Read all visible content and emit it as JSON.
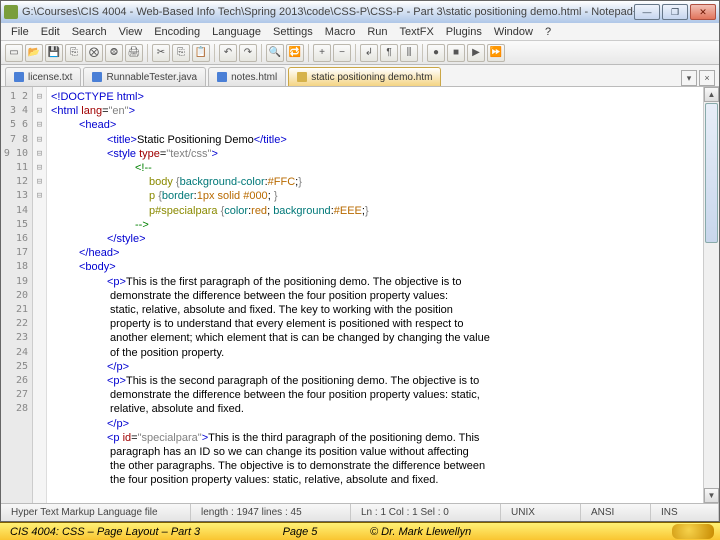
{
  "titlebar": {
    "title": "G:\\Courses\\CIS 4004 - Web-Based Info Tech\\Spring 2013\\code\\CSS-P\\CSS-P - Part 3\\static positioning demo.html - Notepad++"
  },
  "menubar": [
    "File",
    "Edit",
    "Search",
    "View",
    "Encoding",
    "Language",
    "Settings",
    "Macro",
    "Run",
    "TextFX",
    "Plugins",
    "Window",
    "?"
  ],
  "tabs": [
    {
      "label": "license.txt",
      "active": false,
      "color": "blue"
    },
    {
      "label": "RunnableTester.java",
      "active": false,
      "color": "blue"
    },
    {
      "label": "notes.html",
      "active": false,
      "color": "blue"
    },
    {
      "label": "static positioning demo.htm",
      "active": true,
      "color": "yel"
    }
  ],
  "lines": [
    {
      "n": 1,
      "f": "",
      "html": "<span class='c-blue'>&lt;!DOCTYPE html&gt;</span>"
    },
    {
      "n": 2,
      "f": "⊟",
      "html": "<span class='c-blue'>&lt;html</span> <span class='c-red'>lang</span>=<span class='c-gray'>\"en\"</span><span class='c-blue'>&gt;</span>"
    },
    {
      "n": 3,
      "f": "⊟",
      "html": "<span class='in1'><span class='c-blue'>&lt;head&gt;</span></span>"
    },
    {
      "n": 4,
      "f": "",
      "html": "<span class='in2'><span class='c-blue'>&lt;title&gt;</span>Static Positioning Demo<span class='c-blue'>&lt;/title&gt;</span></span>"
    },
    {
      "n": 5,
      "f": "⊟",
      "html": "<span class='in2'><span class='c-blue'>&lt;style</span> <span class='c-red'>type</span>=<span class='c-gray'>\"text/css\"</span><span class='c-blue'>&gt;</span></span>"
    },
    {
      "n": 6,
      "f": "⊟",
      "html": "<span class='in3'><span class='c-green'>&lt;!--</span></span>"
    },
    {
      "n": 7,
      "f": "",
      "html": "<span class='in4'><span class='c-olive'>body</span> <span class='c-gray'>{</span><span class='c-teal'>background-color</span>:<span class='c-orange'>#FFC</span>;<span class='c-gray'>}</span></span>"
    },
    {
      "n": 8,
      "f": "",
      "html": "<span class='in4'><span class='c-olive'>p</span> <span class='c-gray'>{</span><span class='c-teal'>border</span>:<span class='c-orange'>1px solid #000</span>; <span class='c-gray'>}</span></span>"
    },
    {
      "n": 9,
      "f": "",
      "html": "<span class='in4'><span class='c-olive'>p#specialpara</span> <span class='c-gray'>{</span><span class='c-teal'>color</span>:<span class='c-orange'>red</span>; <span class='c-teal'>background</span>:<span class='c-orange'>#EEE</span>;<span class='c-gray'>}</span></span>"
    },
    {
      "n": 10,
      "f": "",
      "html": "<span class='in3'><span class='c-green'>--&gt;</span></span>"
    },
    {
      "n": 11,
      "f": "",
      "html": "<span class='in2'><span class='c-blue'>&lt;/style&gt;</span></span>"
    },
    {
      "n": 12,
      "f": "",
      "html": "<span class='in1'><span class='c-blue'>&lt;/head&gt;</span></span>"
    },
    {
      "n": 13,
      "f": "⊟",
      "html": "<span class='in1'><span class='c-blue'>&lt;body&gt;</span></span>"
    },
    {
      "n": 14,
      "f": "⊟",
      "html": "<span class='in2'><span class='c-blue'>&lt;p&gt;</span>This is the first paragraph of the positioning demo. The objective is to</span>"
    },
    {
      "n": 15,
      "f": "",
      "html": "<span class='in2'> demonstrate the difference between the four position property values:</span>"
    },
    {
      "n": 16,
      "f": "",
      "html": "<span class='in2'> static, relative, absolute and fixed. The key to working with the position</span>"
    },
    {
      "n": 17,
      "f": "",
      "html": "<span class='in2'> property is to understand that every element is positioned with respect to</span>"
    },
    {
      "n": 18,
      "f": "",
      "html": "<span class='in2'> another element; which element that is can be changed by changing the value</span>"
    },
    {
      "n": 19,
      "f": "",
      "html": "<span class='in2'> of the position property.</span>"
    },
    {
      "n": 20,
      "f": "",
      "html": "<span class='in2'><span class='c-blue'>&lt;/p&gt;</span></span>"
    },
    {
      "n": 21,
      "f": "⊟",
      "html": "<span class='in2'><span class='c-blue'>&lt;p&gt;</span>This is the second paragraph of the positioning demo. The objective is to</span>"
    },
    {
      "n": 22,
      "f": "",
      "html": "<span class='in2'> demonstrate the difference between the four position property values: static,</span>"
    },
    {
      "n": 23,
      "f": "",
      "html": "<span class='in2'> relative, absolute and fixed.</span>"
    },
    {
      "n": 24,
      "f": "",
      "html": "<span class='in2'><span class='c-blue'>&lt;/p&gt;</span></span>"
    },
    {
      "n": 25,
      "f": "⊟",
      "html": "<span class='in2'><span class='c-blue'>&lt;p</span> <span class='c-red'>id</span>=<span class='c-gray'>\"specialpara\"</span><span class='c-blue'>&gt;</span>This is the third paragraph of the positioning demo. This</span>"
    },
    {
      "n": 26,
      "f": "",
      "html": "<span class='in2'> paragraph has an ID so we can change its position value without affecting</span>"
    },
    {
      "n": 27,
      "f": "",
      "html": "<span class='in2'> the other paragraphs. The objective is to demonstrate the difference between</span>"
    },
    {
      "n": 28,
      "f": "",
      "html": "<span class='in2'> the four position property values: static, relative, absolute and fixed.</span>"
    }
  ],
  "statusbar": {
    "filetype": "Hyper Text Markup Language file",
    "length": "length : 1947   lines : 45",
    "pos": "Ln : 1   Col : 1   Sel : 0",
    "eol": "UNIX",
    "enc": "ANSI",
    "ins": "INS"
  },
  "footer": {
    "left": "CIS 4004: CSS – Page Layout – Part 3",
    "center": "Page 5",
    "right": "© Dr. Mark Llewellyn"
  }
}
